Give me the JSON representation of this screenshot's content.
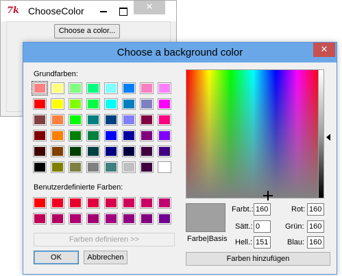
{
  "bg_window": {
    "icon": "tk-feather-icon",
    "title": "ChooseColor",
    "min_glyph": "",
    "max_glyph": "",
    "close_glyph": "✕",
    "button_label": "Choose a color..."
  },
  "dialog": {
    "title": "Choose a background color",
    "close_glyph": "✕",
    "basic_label": "Grundfarben:",
    "custom_label": "Benutzerdefinierte Farben:",
    "define_button": "Farben definieren >>",
    "ok_button": "OK",
    "cancel_button": "Abbrechen",
    "add_button": "Farben hinzufügen",
    "preview_label": "Farbe|Basis",
    "fields": {
      "hue_label": "Farbt.:",
      "hue": "160",
      "sat_label": "Sätt.:",
      "sat": "0",
      "lum_label": "Hell.:",
      "lum": "151",
      "red_label": "Rot:",
      "red": "160",
      "green_label": "Grün:",
      "green": "160",
      "blue_label": "Blau:",
      "blue": "160"
    },
    "preview_color": "#a0a0a0",
    "selected_basic_index": 0,
    "basic_colors": [
      "#ff8080",
      "#ffff80",
      "#80ff80",
      "#00ff80",
      "#80ffff",
      "#0080ff",
      "#ff80c0",
      "#ff80ff",
      "#ff0000",
      "#ffff00",
      "#80ff00",
      "#00ff40",
      "#00ffff",
      "#0080c0",
      "#8080c0",
      "#ff00ff",
      "#804040",
      "#ff8040",
      "#00ff00",
      "#008080",
      "#004080",
      "#8080ff",
      "#800040",
      "#ff0080",
      "#800000",
      "#ff8000",
      "#008000",
      "#008040",
      "#0000ff",
      "#0000a0",
      "#800080",
      "#8000ff",
      "#400000",
      "#804000",
      "#004000",
      "#004040",
      "#000080",
      "#000040",
      "#400040",
      "#400080",
      "#000000",
      "#808000",
      "#808040",
      "#808080",
      "#408080",
      "#c0c0c0",
      "#400040",
      "#ffffff"
    ],
    "custom_colors": [
      "#ff0000",
      "#f00020",
      "#e8002e",
      "#e00040",
      "#d8004c",
      "#d0005a",
      "#c80064",
      "#c00070",
      "#c00058",
      "#b00060",
      "#b00070",
      "#a00070",
      "#a00080",
      "#900080",
      "#800080",
      "#700090"
    ]
  }
}
